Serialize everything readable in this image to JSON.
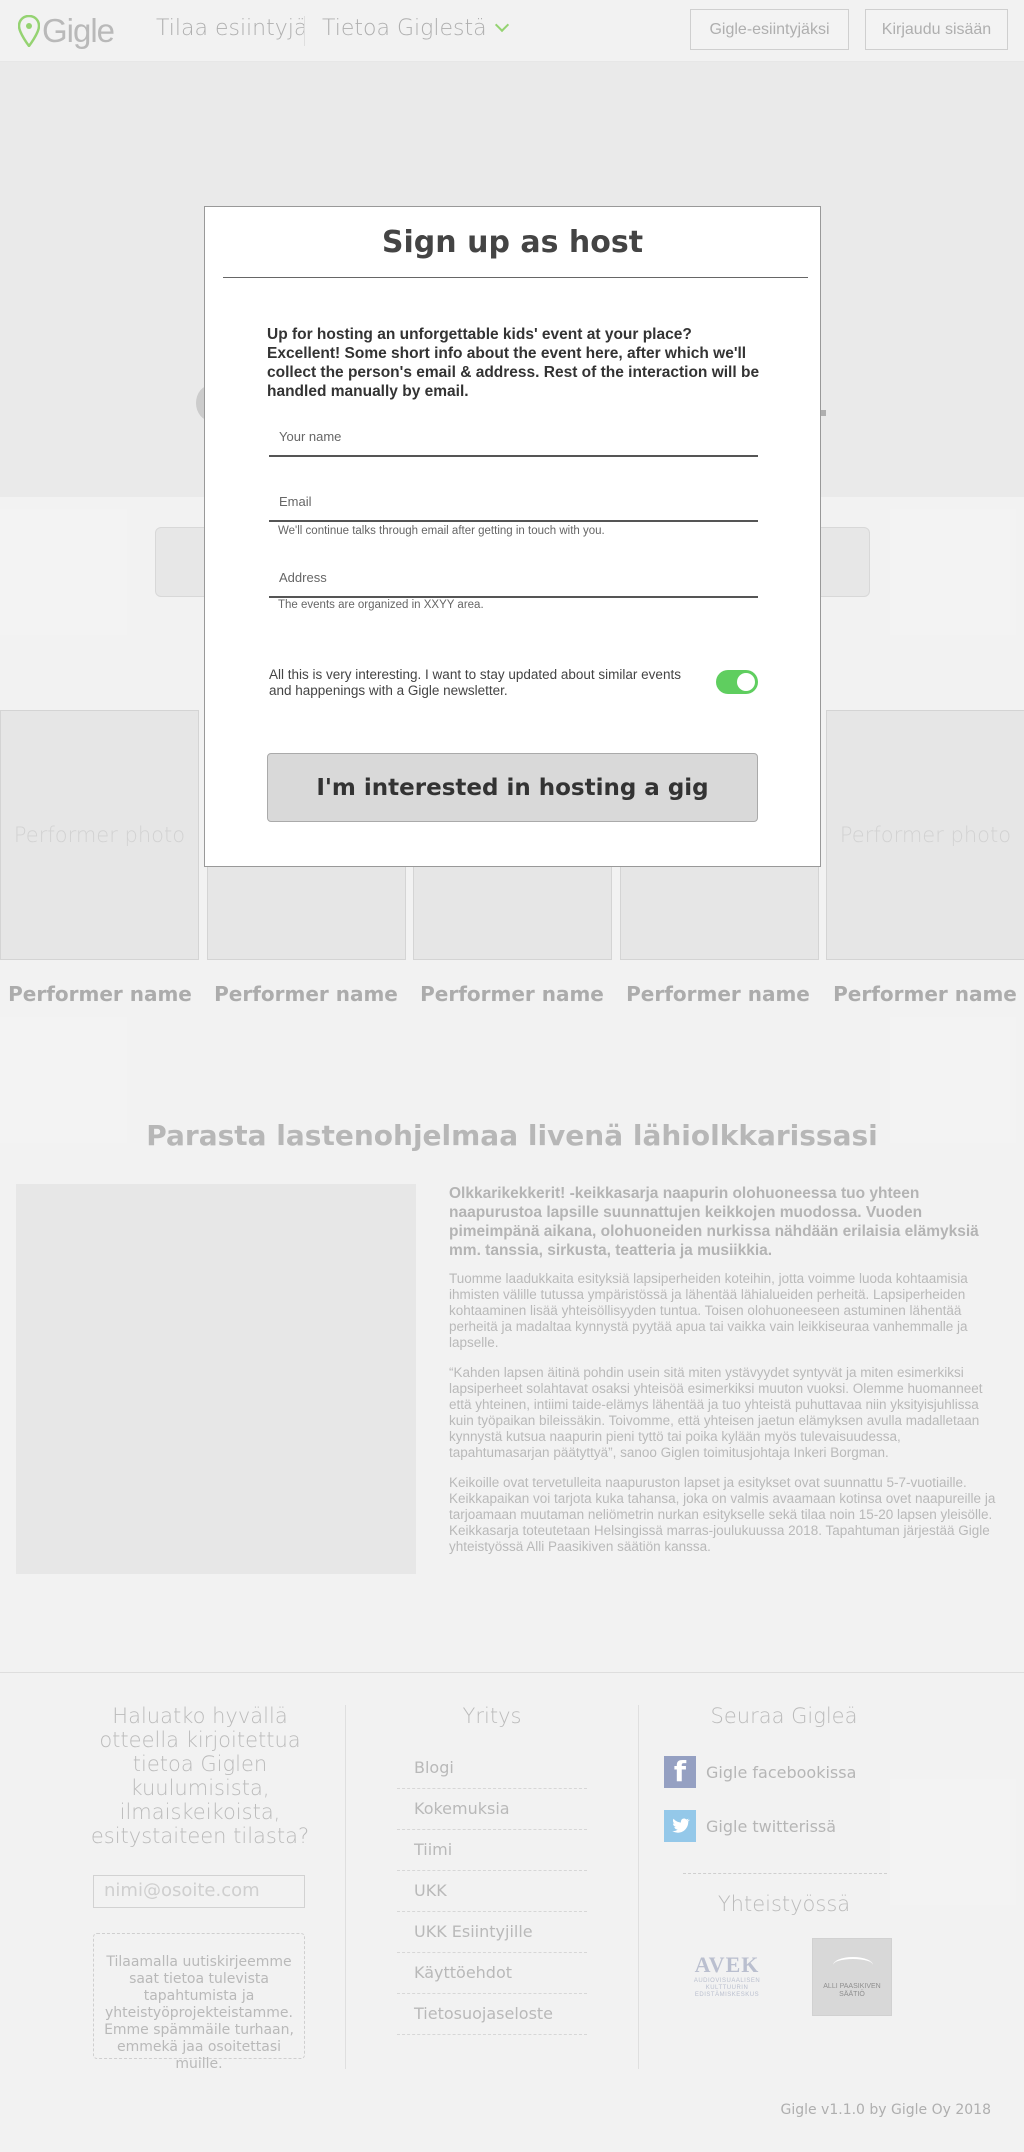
{
  "header": {
    "logo_text": "Gigle",
    "nav": {
      "order_samples": "Tilaa esiintyjä",
      "about": "Tietoa Giglestä"
    },
    "buttons": {
      "performers": "Gigle-esiintyjäksi",
      "login": "Kirjaudu sisään"
    }
  },
  "performers": [
    {
      "photo_label": "Performer photo",
      "name": "Performer name"
    },
    {
      "photo_label": "",
      "name": "Performer name"
    },
    {
      "photo_label": "",
      "name": "Performer name"
    },
    {
      "photo_label": "",
      "name": "Performer name"
    },
    {
      "photo_label": "Performer photo",
      "name": "Performer name"
    }
  ],
  "about": {
    "title": "Parasta lastenohjelmaa livenä lähiolkkarissasi",
    "lead": "Olkkarikekkerit! -keikkasarja naapurin olohuoneessa tuo yhteen naapurustoa lapsille suunnattujen keikkojen muodossa. Vuoden pimeimpänä aikana, olohuoneiden nurkissa nähdään erilaisia elämyksiä mm. tanssia, sirkusta, teatteria ja musiikkia.",
    "p1": "Tuomme laadukkaita esityksiä lapsiperheiden koteihin, jotta voimme luoda kohtaamisia ihmisten välille tutussa ympäristössä ja lähentää lähialueiden perheitä. Lapsiperheiden kohtaaminen lisää yhteisöllisyyden tuntua. Toisen olohuoneeseen astuminen lähentää perheitä ja madaltaa kynnystä pyytää apua tai vaikka vain leikkiseuraa vanhemmalle ja lapselle.",
    "p2": "“Kahden lapsen äitinä pohdin usein sitä miten ystävyydet syntyvät ja miten esimerkiksi lapsiperheet solahtavat osaksi yhteisöä esimerkiksi muuton vuoksi. Olemme huomanneet että yhteinen, intiimi taide-elämys lähentää ja tuo yhteistä puhuttavaa niin yksityisjuhlissa kuin työpaikan bileissäkin. Toivomme, että yhteisen jaetun elämyksen avulla madalletaan kynnystä kutsua naapurin pieni tyttö tai poika kylään myös tulevaisuudessa, tapahtumasarjan päätyttyä”, sanoo Giglen toimitusjohtaja Inkeri Borgman.",
    "p3": "Keikoille ovat tervetulleita naapuruston lapset ja esitykset ovat suunnattu 5-7-vuotiaille. Keikkapaikan voi tarjota kuka tahansa, joka on valmis avaamaan kotinsa ovet naapureille ja tarjoamaan muutaman neliömetrin nurkan esitykselle sekä tilaa noin 15-20 lapsen yleisölle. Keikkasarja toteutetaan Helsingissä marras-joulukuussa 2018. Tapahtuman järjestää Gigle yhteistyössä Alli Paasikiven säätiön kanssa."
  },
  "footer": {
    "newsletter_title": "Haluatko hyvällä otteella kirjoitettua tietoa Giglen kuulumisista, ilmaiskeikoista, esitystaiteen tilasta?",
    "email_placeholder": "nimi@osoite.com",
    "newsletter_note": "Tilaamalla uutiskirjeemme saat tietoa tulevista tapahtumista ja yhteistyöprojekteistamme. Emme spämmäile turhaan, emmekä jaa osoitettasi muille.",
    "company_title": "Yritys",
    "company_links": [
      "Blogi",
      "Kokemuksia",
      "Tiimi",
      "UKK",
      "UKK Esiintyjille",
      "Käyttöehdot",
      "Tietosuojaseloste"
    ],
    "follow_title": "Seuraa Gigleä",
    "facebook": "Gigle facebookissa",
    "twitter": "Gigle twitterissä",
    "partners_title": "Yhteistyössä",
    "avek_name": "AVEK",
    "avek_sub": "AUDIOVISUAALISEN KULTTUURIN EDISTÄMISKESKUS",
    "alli_text": "ALLI PAASIKIVEN SÄÄTIÖ",
    "copyright": "Gigle v1.1.0 by Gigle Oy 2018"
  },
  "modal": {
    "title": "Sign up as host",
    "intro": "Up for hosting an unforgettable kids' event at your place? Excellent! Some short info about the event here, after which we'll collect the person's email & address. Rest of the interaction will be handled manually by email.",
    "name_placeholder": "Your name",
    "email_placeholder": "Email",
    "email_help": "We'll continue talks through email after getting in touch with you.",
    "address_placeholder": "Address",
    "address_help": "The events are organized in XXYY area.",
    "newsletter_label": "All this is very interesting. I want to stay updated about similar events and happenings with a Gigle newsletter.",
    "newsletter_enabled": true,
    "submit_label": "I'm interested in hosting a gig"
  },
  "colors": {
    "accent_green": "#8fd16a",
    "toggle_on": "#5fce5f"
  }
}
